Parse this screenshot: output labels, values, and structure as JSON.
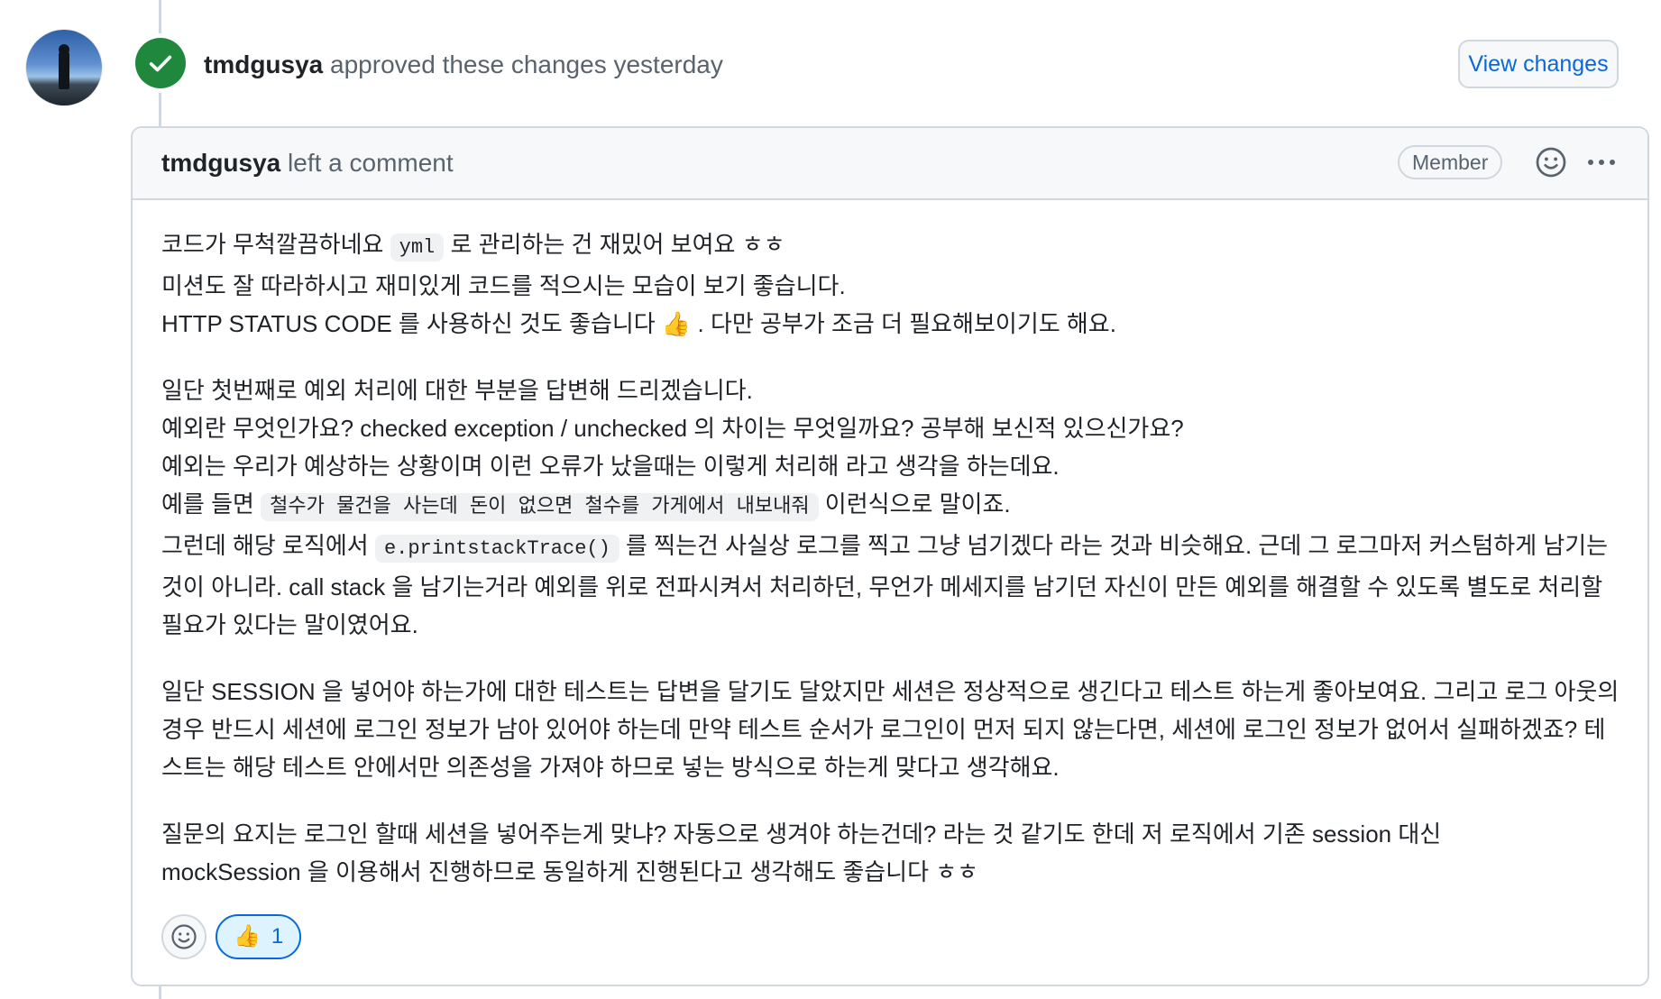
{
  "review": {
    "author": "tmdgusya",
    "action": " approved these changes yesterday",
    "view_changes_label": "View changes"
  },
  "comment": {
    "author": "tmdgusya",
    "action": " left a comment",
    "role_badge": "Member",
    "paragraphs": [
      [
        [
          "코드가 무척깔끔하네요 ",
          [
            "yml"
          ],
          " 로 관리하는 건 재밌어 보여요 ㅎㅎ"
        ],
        [
          "미션도 잘 따라하시고 재미있게 코드를 적으시는 모습이 보기 좋습니다."
        ],
        [
          "HTTP STATUS CODE 를 사용하신 것도 좋습니다 👍 . 다만 공부가 조금 더 필요해보이기도 해요."
        ]
      ],
      [
        [
          "일단 첫번째로 예외 처리에 대한 부분을 답변해 드리겠습니다."
        ],
        [
          "예외란 무엇인가요? checked exception / unchecked 의 차이는 무엇일까요? 공부해 보신적 있으신가요?"
        ],
        [
          "예외는 우리가 예상하는 상황이며 이런 오류가 났을때는 이렇게 처리해 라고 생각을 하는데요."
        ],
        [
          "예를 들면 ",
          [
            "철수가 물건을 사는데 돈이 없으면 철수를 가게에서 내보내줘"
          ],
          " 이런식으로 말이죠."
        ],
        [
          "그런데 해당 로직에서 ",
          [
            "e.printstackTrace()"
          ],
          " 를 찍는건 사실상 로그를 찍고 그냥 넘기겠다 라는 것과 비슷해요. 근데 그 로그마저 커스텀하게 남기는 것이 아니라. call stack 을 남기는거라 예외를 위로 전파시켜서 처리하던, 무언가 메세지를 남기던 자신이 만든 예외를 해결할 수 있도록 별도로 처리할 필요가 있다는 말이였어요."
        ]
      ],
      [
        [
          "일단 SESSION 을 넣어야 하는가에 대한 테스트는 답변을 달기도 달았지만 세션은 정상적으로 생긴다고 테스트 하는게 좋아보여요. 그리고 로그 아웃의 경우 반드시 세션에 로그인 정보가 남아 있어야 하는데 만약 테스트 순서가 로그인이 먼저 되지 않는다면, 세션에 로그인 정보가 없어서 실패하겠죠? 테스트는 해당 테스트 안에서만 의존성을 가져야 하므로 넣는 방식으로 하는게 맞다고 생각해요."
        ]
      ],
      [
        [
          "질문의 요지는 로그인 할때 세션을 넣어주는게 맞냐? 자동으로 생겨야 하는건데? 라는 것 같기도 한데 저 로직에서 기존 session 대신"
        ],
        [
          "mockSession 을 이용해서 진행하므로 동일하게 진행된다고 생각해도 좋습니다 ㅎㅎ"
        ]
      ]
    ],
    "reactions": [
      {
        "emoji": "👍",
        "count": "1"
      }
    ]
  },
  "colors": {
    "approved_green": "#1f883d",
    "link_blue": "#0969da",
    "border": "#d0d7de",
    "muted_text": "#59636e"
  },
  "icons": [
    "check-icon",
    "smiley-icon",
    "kebab-menu-icon",
    "add-reaction-icon",
    "thumbs-up-emoji"
  ]
}
